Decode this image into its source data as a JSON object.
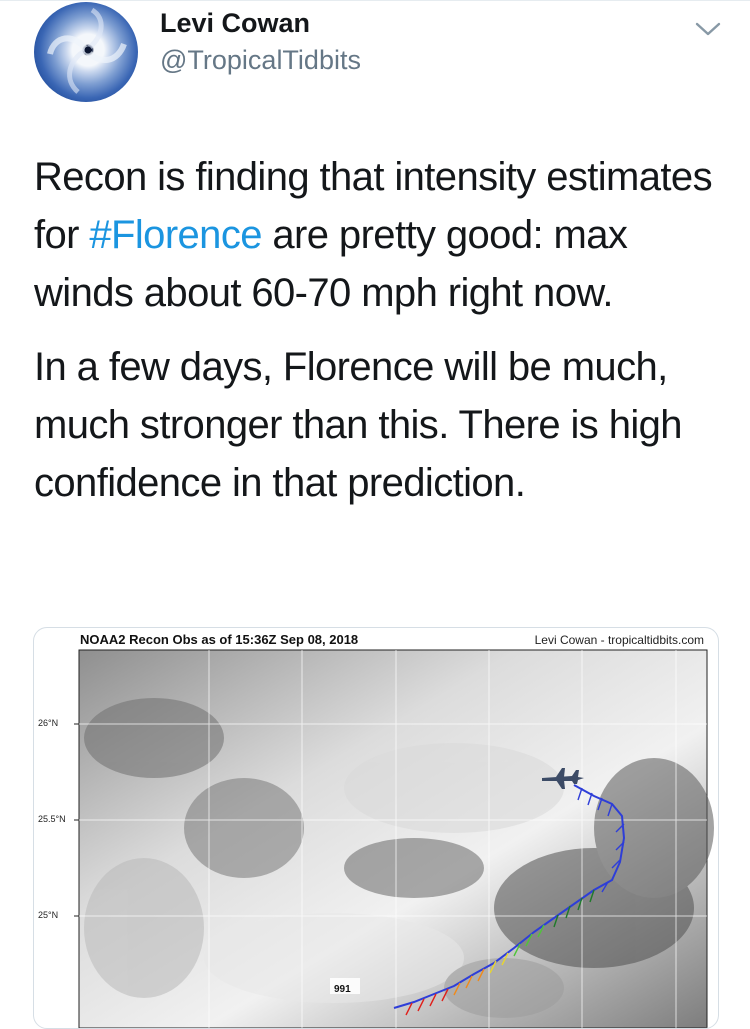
{
  "tweet": {
    "author": {
      "display_name": "Levi Cowan",
      "handle": "@TropicalTidbits",
      "avatar_icon": "hurricane-satellite-avatar"
    },
    "menu_icon": "chevron-down-icon",
    "paragraph_1": {
      "before": "Recon is finding that intensity estimates for ",
      "hashtag": "#Florence",
      "after": " are pretty good: max winds about 60-70 mph right now."
    },
    "paragraph_2": "In a few days, Florence will be much, much stronger than this. There is high confidence in that prediction.",
    "hashtag_color": "#1b95e0"
  },
  "media": {
    "title": "NOAA2 Recon Obs as of 15:36Z Sep 08, 2018",
    "credit": "Levi Cowan - tropicaltidbits.com",
    "lat_labels": [
      "26°N",
      "25.5°N",
      "25°N"
    ],
    "pressure_value": "991",
    "aircraft_icon": "aircraft-icon",
    "wind_barb_colors": [
      "#e0201b",
      "#f08a1a",
      "#e8d530",
      "#4fc43a",
      "#1f7a2a",
      "#2e3ed8"
    ]
  }
}
